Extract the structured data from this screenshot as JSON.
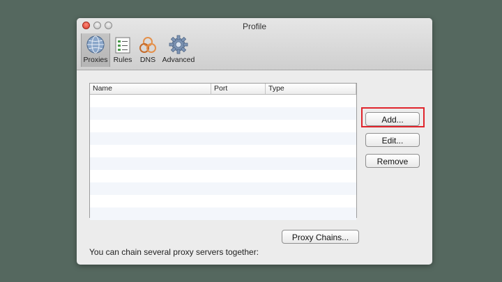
{
  "window": {
    "title": "Profile"
  },
  "toolbar": {
    "items": [
      {
        "label": "Proxies",
        "icon": "globe-icon",
        "active": true
      },
      {
        "label": "Rules",
        "icon": "rules-list-icon",
        "active": false
      },
      {
        "label": "DNS",
        "icon": "dns-network-icon",
        "active": false
      },
      {
        "label": "Advanced",
        "icon": "gear-icon",
        "active": false
      }
    ]
  },
  "table": {
    "columns": [
      "Name",
      "Port",
      "Type"
    ],
    "rows": []
  },
  "buttons": {
    "add": "Add...",
    "edit": "Edit...",
    "remove": "Remove",
    "proxy_chains": "Proxy Chains..."
  },
  "footer": {
    "chain_text": "You can chain several proxy servers together:"
  },
  "colors": {
    "background": "#55685f",
    "highlight": "#e0242c"
  }
}
